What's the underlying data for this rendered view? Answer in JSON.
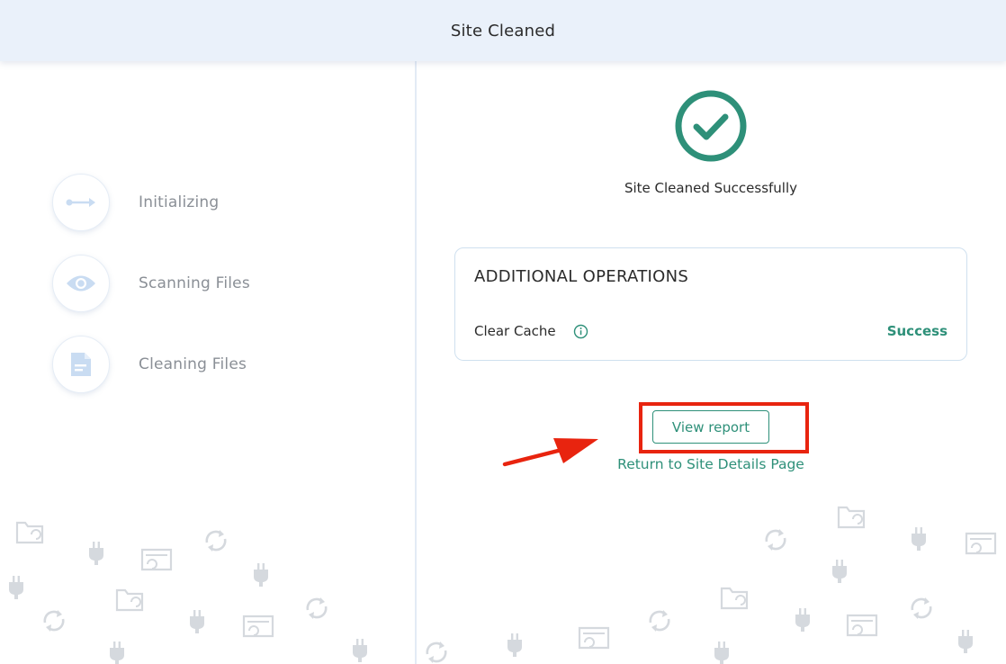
{
  "header": {
    "title": "Site Cleaned"
  },
  "steps": [
    {
      "label": "Initializing",
      "icon": "arrow-line-icon"
    },
    {
      "label": "Scanning Files",
      "icon": "eye-icon"
    },
    {
      "label": "Cleaning Files",
      "icon": "document-icon"
    }
  ],
  "result": {
    "message": "Site Cleaned Successfully",
    "icon": "check-circle-icon"
  },
  "operations": {
    "title": "ADDITIONAL OPERATIONS",
    "items": [
      {
        "label": "Clear Cache",
        "status": "Success"
      }
    ]
  },
  "actions": {
    "view_report": "View report",
    "return_link": "Return to Site Details Page"
  },
  "colors": {
    "accent": "#2e9079",
    "header_bg": "#eaf1fa",
    "highlight": "#e8240f",
    "icon_light": "#c9dcf2"
  }
}
